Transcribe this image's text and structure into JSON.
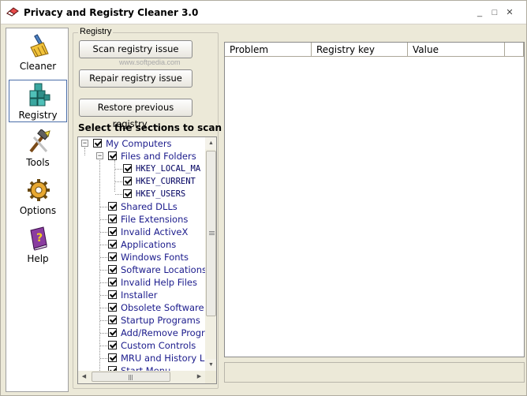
{
  "window": {
    "title": "Privacy and Registry Cleaner 3.0",
    "minimize_glyph": "_",
    "maximize_glyph": "□",
    "close_glyph": "✕"
  },
  "nav": {
    "items": [
      {
        "label": "Cleaner",
        "icon": "broom-icon"
      },
      {
        "label": "Registry",
        "icon": "registry-cubes-icon"
      },
      {
        "label": "Tools",
        "icon": "tools-icon"
      },
      {
        "label": "Options",
        "icon": "gear-icon"
      },
      {
        "label": "Help",
        "icon": "help-book-icon"
      }
    ],
    "active": "Registry"
  },
  "registry": {
    "group_label": "Registry",
    "scan_button": "Scan registry issue",
    "repair_button": "Repair registry issue",
    "restore_button": "Restore previous registry ...",
    "watermark": "www.softpedia.com",
    "sections_heading": "Select the sections to scan",
    "tree": [
      {
        "label": "My Computers",
        "checked": true,
        "level": 0,
        "expanded": true
      },
      {
        "label": "Files and Folders",
        "checked": true,
        "level": 1,
        "expanded": true
      },
      {
        "label": "HKEY_LOCAL_MA",
        "checked": true,
        "level": 2
      },
      {
        "label": "HKEY_CURRENT",
        "checked": true,
        "level": 2
      },
      {
        "label": "HKEY_USERS",
        "checked": true,
        "level": 2
      },
      {
        "label": "Shared DLLs",
        "checked": true,
        "level": 1
      },
      {
        "label": "File Extensions",
        "checked": true,
        "level": 1
      },
      {
        "label": "Invalid ActiveX",
        "checked": true,
        "level": 1
      },
      {
        "label": "Applications",
        "checked": true,
        "level": 1
      },
      {
        "label": "Windows Fonts",
        "checked": true,
        "level": 1
      },
      {
        "label": "Software Locations",
        "checked": true,
        "level": 1
      },
      {
        "label": "Invalid Help Files",
        "checked": true,
        "level": 1
      },
      {
        "label": "Installer",
        "checked": true,
        "level": 1
      },
      {
        "label": "Obsolete Software",
        "checked": true,
        "level": 1
      },
      {
        "label": "Startup Programs",
        "checked": true,
        "level": 1
      },
      {
        "label": "Add/Remove Program",
        "checked": true,
        "level": 1
      },
      {
        "label": "Custom Controls",
        "checked": true,
        "level": 1
      },
      {
        "label": "MRU and History Lists",
        "checked": true,
        "level": 1
      },
      {
        "label": "Start Menu",
        "checked": true,
        "level": 1
      }
    ]
  },
  "results": {
    "columns": [
      "Problem",
      "Registry key",
      "Value"
    ]
  },
  "colors": {
    "window_bg": "#ece9d8",
    "tree_text": "#1b1b8c",
    "nav_active_border": "#4a6ea9"
  }
}
